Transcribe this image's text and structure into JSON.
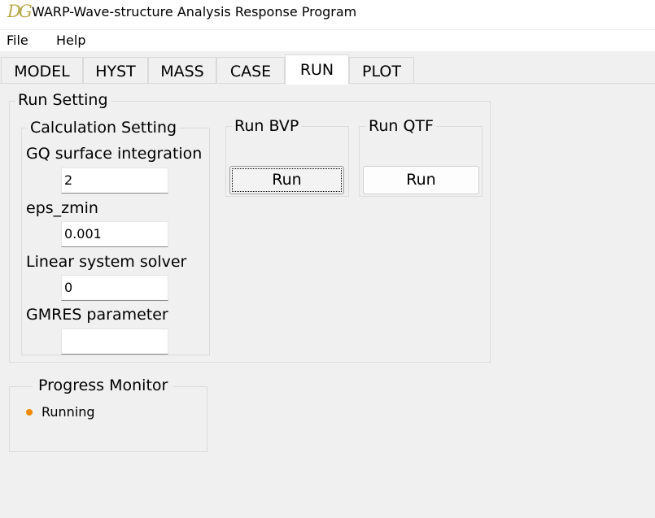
{
  "window": {
    "title": "WARP-Wave-structure Analysis Response Program",
    "icon_text": "DG",
    "icon_color": "#b8a94a"
  },
  "menu": {
    "items": [
      "File",
      "Help"
    ]
  },
  "tabs": [
    "MODEL",
    "HYST",
    "MASS",
    "CASE",
    "RUN",
    "PLOT"
  ],
  "active_tab": "RUN",
  "run_setting": {
    "title": "Run Setting",
    "calc": {
      "title": "Calculation Setting",
      "gq_label": "GQ surface integration",
      "gq_value": "2",
      "eps_label": "eps_zmin",
      "eps_value": "0.001",
      "solver_label": "Linear system solver",
      "solver_value": "0",
      "gmres_label": "GMRES parameter",
      "gmres_value": ""
    },
    "bvp": {
      "title": "Run BVP",
      "button": "Run"
    },
    "qtf": {
      "title": "Run QTF",
      "button": "Run"
    }
  },
  "progress": {
    "title": "Progress Monitor",
    "status": "Running",
    "status_color": "#f08a00"
  }
}
